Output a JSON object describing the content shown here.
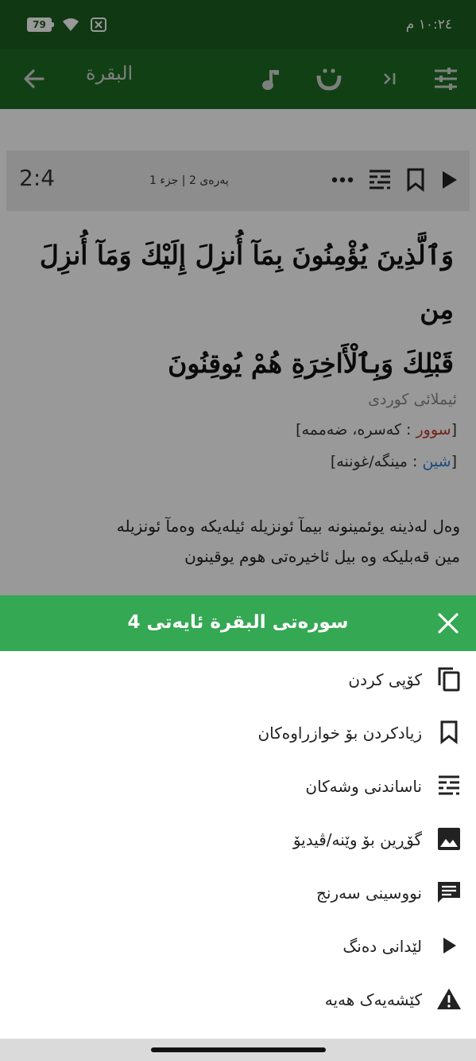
{
  "status": {
    "time": "١٠:٢٤ م",
    "battery": "79"
  },
  "appbar": {
    "title": "البقرة",
    "icons": [
      "tune-icon",
      "next-icon",
      "text-icon",
      "music-icon",
      "back-arrow-icon"
    ]
  },
  "verse": {
    "number": "2:4",
    "para": "پەرەی 2 | جزء 1",
    "arabic_line1": "وَٱلَّذِينَ يُؤْمِنُونَ بِمَآ أُنزِلَ إِلَيْكَ وَمَآ أُنزِلَ مِن",
    "arabic_line2": "قَبْلِكَ وَبِٱلْأَاخِرَةِ هُمْ يُوقِنُونَ"
  },
  "legend": {
    "title": "ئیملائی کوردی",
    "row1": [
      "[",
      "سوور",
      " : کەسرە، ضەممە]"
    ],
    "row2": [
      "[",
      "شین",
      " : مینگە/غوننە]"
    ]
  },
  "translit": {
    "line1": "وەل لەذینە یوئمینونە بیمآ ئونزیلە ئیلەیکە وەمآ ئونزیلە",
    "line2": "مین قەبلیکە وە بیل ئاخیرەتی هوم یوقینون"
  },
  "sheet": {
    "title": "سورەتی البقرة ئایەتی 4",
    "items": [
      {
        "label": "کۆپی کردن",
        "icon": "copy-icon"
      },
      {
        "label": "زیادکردن بۆ خوازراوەکان",
        "icon": "bookmark-icon"
      },
      {
        "label": "ناساندنی وشەکان",
        "icon": "word-grid-icon"
      },
      {
        "label": "گۆڕین بۆ وێنە/ڤیدیۆ",
        "icon": "image-icon"
      },
      {
        "label": "نووسینی سەرنج",
        "icon": "note-icon"
      },
      {
        "label": "لێدانی دەنگ",
        "icon": "play-icon"
      },
      {
        "label": "کێشەیەک هەیە",
        "icon": "warning-icon"
      }
    ]
  },
  "colors": {
    "primary_dark": "#1b5e20",
    "primary": "#1e6b24",
    "sheet_header": "#34a853"
  }
}
